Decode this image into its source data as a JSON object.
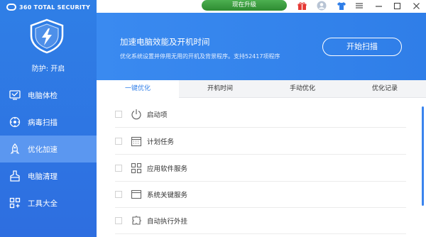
{
  "app": {
    "brand": "360 TOTAL SECURITY"
  },
  "sidebar": {
    "status": "防护: 开启",
    "items": [
      {
        "label": "电脑体检",
        "icon": "checkup-icon",
        "active": false
      },
      {
        "label": "病毒扫描",
        "icon": "virus-scan-icon",
        "active": false
      },
      {
        "label": "优化加速",
        "icon": "speedup-icon",
        "active": true
      },
      {
        "label": "电脑清理",
        "icon": "cleanup-icon",
        "active": false
      },
      {
        "label": "工具大全",
        "icon": "tools-icon",
        "active": false
      }
    ]
  },
  "topbar": {
    "upgrade_label": "现在升级",
    "icons": [
      "gift-icon",
      "avatar-icon",
      "shirt-icon",
      "menu-icon",
      "minimize-icon",
      "maximize-icon",
      "close-icon"
    ]
  },
  "banner": {
    "title": "加速电脑效能及开机时间",
    "subtitle": "优化系统设置并停用无用的开机及背景程序。支持52417项程序",
    "scan_label": "开始扫描"
  },
  "tabs": [
    {
      "label": "一键优化",
      "active": true
    },
    {
      "label": "开机时间",
      "active": false
    },
    {
      "label": "手动优化",
      "active": false
    },
    {
      "label": "优化记录",
      "active": false
    }
  ],
  "list": [
    {
      "label": "启动项",
      "icon": "power-icon"
    },
    {
      "label": "计划任务",
      "icon": "calendar-icon"
    },
    {
      "label": "应用软件服务",
      "icon": "apps-icon"
    },
    {
      "label": "系统关键服务",
      "icon": "window-icon"
    },
    {
      "label": "自动执行外挂",
      "icon": "plugin-icon"
    }
  ],
  "colors": {
    "accent": "#2f7ee8",
    "upgrade": "#3a9b3e"
  }
}
